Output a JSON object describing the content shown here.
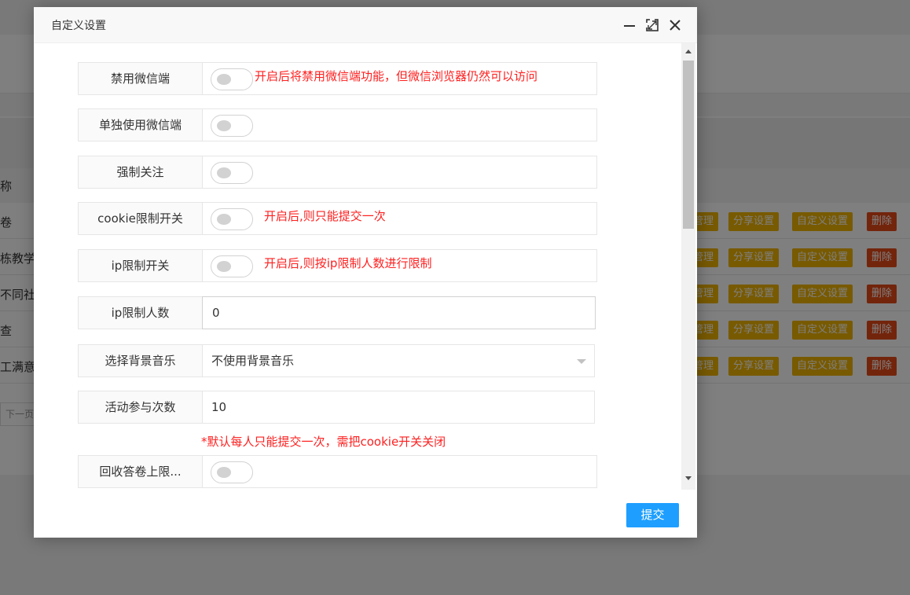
{
  "background": {
    "table_header_partial": "称",
    "rows": [
      {
        "name_partial": "卷"
      },
      {
        "name_partial": "栋教学"
      },
      {
        "name_partial": "不同社"
      },
      {
        "name_partial": "查"
      },
      {
        "name_partial": "工满意"
      }
    ],
    "row_actions": {
      "manage_partial": "管理",
      "share": "分享设置",
      "custom": "自定义设置",
      "delete": "删除"
    },
    "pager_next_partial": "下一页"
  },
  "dialog": {
    "title": "自定义设置",
    "controls": {
      "minimize": "minimize-icon",
      "maximize": "maximize-icon",
      "close": "close-icon"
    },
    "fields": {
      "disable_wechat": {
        "label": "禁用微信端",
        "checked": false,
        "tip": "开启后将禁用微信端功能，但微信浏览器仍然可以访问"
      },
      "wechat_only": {
        "label": "单独使用微信端",
        "checked": false
      },
      "force_follow": {
        "label": "强制关注",
        "checked": false
      },
      "cookie_limit": {
        "label": "cookie限制开关",
        "checked": false,
        "tip": "开启后,则只能提交一次"
      },
      "ip_limit": {
        "label": "ip限制开关",
        "checked": false,
        "tip": "开启后,则按ip限制人数进行限制"
      },
      "ip_limit_count": {
        "label": "ip限制人数",
        "value": "0"
      },
      "bg_music": {
        "label": "选择背景音乐",
        "value": "不使用背景音乐"
      },
      "participation_count": {
        "label": "活动参与次数",
        "value": "10",
        "note": "*默认每人只能提交一次，需把cookie开关关闭"
      },
      "recycle_limit": {
        "label": "回收答卷上限...",
        "checked": false
      }
    },
    "submit_label": "提交"
  },
  "colors": {
    "accent": "#1e9fff",
    "tip_red": "#ff2020",
    "button_yellow": "#f0b400",
    "button_red": "#e64a19"
  }
}
